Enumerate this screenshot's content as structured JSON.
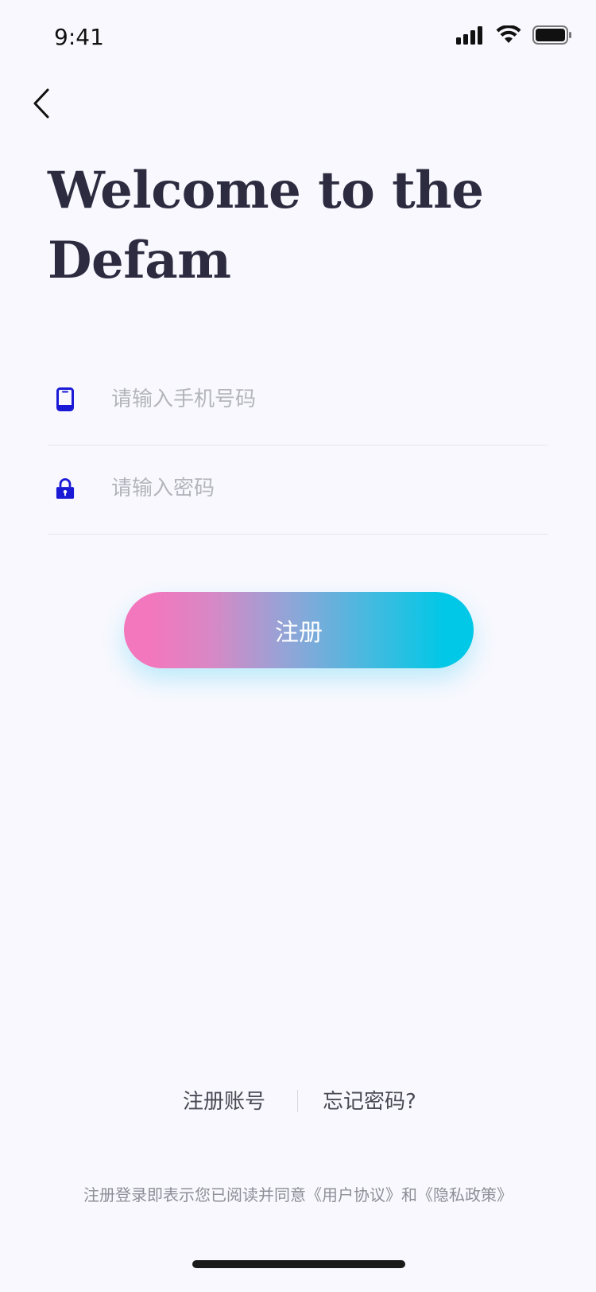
{
  "status_bar": {
    "time": "9:41",
    "icons": [
      "signal-icon",
      "wifi-icon",
      "battery-icon"
    ]
  },
  "header": {
    "back_icon": "chevron-left-icon"
  },
  "title": {
    "line1": "Welcome to the",
    "line2": "Defam"
  },
  "form": {
    "phone": {
      "icon": "phone-icon",
      "value": "",
      "placeholder": "请输入手机号码"
    },
    "password": {
      "icon": "lock-icon",
      "value": "",
      "placeholder": "请输入密码"
    },
    "submit_label": "注册"
  },
  "links": {
    "register_label": "注册账号",
    "forgot_label": "忘记密码?"
  },
  "agreement": {
    "prefix": "注册登录即表示您已阅读并同意",
    "user_agreement": "《用户协议》",
    "conjunction": "和",
    "privacy_policy": "《隐私政策》"
  },
  "colors": {
    "background": "#f8f8fe",
    "title": "#2d2b40",
    "icon_accent": "#1a1ad6",
    "gradient_start": "#f277bd",
    "gradient_end": "#00c8e6"
  }
}
